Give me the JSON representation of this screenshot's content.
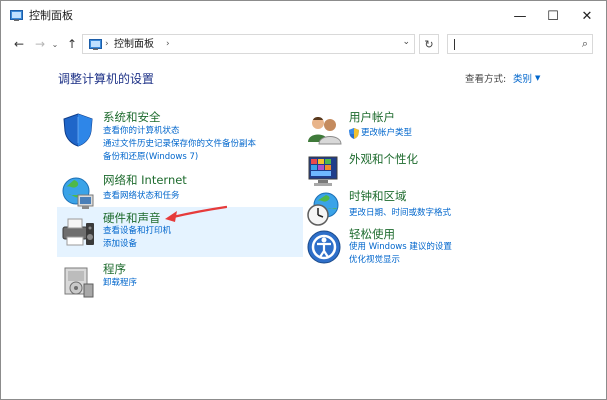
{
  "window": {
    "title": "控制面板",
    "controls": {
      "minimize": "—",
      "maximize": "☐",
      "close": "✕"
    }
  },
  "nav": {
    "back": "←",
    "forward": "→",
    "recent": "⌄",
    "up": "↑",
    "separator": "›",
    "address": "控制面板",
    "dropdown": "⌄",
    "refresh": "↻",
    "search_icon": "⌕"
  },
  "header": {
    "title": "调整计算机的设置",
    "view_by_label": "查看方式:",
    "view_by_value": "类别",
    "view_by_caret": "▼"
  },
  "categories": [
    {
      "icon": "shield-icon",
      "title": "系统和安全",
      "links": [
        "查看你的计算机状态",
        "通过文件历史记录保存你的文件备份副本",
        "备份和还原(Windows 7)"
      ]
    },
    {
      "icon": "network-globe-icon",
      "title": "网络和 Internet",
      "links": [
        "查看网络状态和任务"
      ]
    },
    {
      "icon": "printer-speaker-icon",
      "title": "硬件和声音",
      "links": [
        "查看设备和打印机",
        "添加设备"
      ],
      "highlighted": true
    },
    {
      "icon": "program-box-icon",
      "title": "程序",
      "links": [
        "卸载程序"
      ]
    },
    {
      "icon": "users-icon",
      "title": "用户帐户",
      "links": [
        "更改帐户类型"
      ]
    },
    {
      "icon": "appearance-monitor-icon",
      "title": "外观和个性化",
      "links": []
    },
    {
      "icon": "clock-globe-icon",
      "title": "时钟和区域",
      "links": [
        "更改日期、时间或数字格式"
      ]
    },
    {
      "icon": "accessibility-icon",
      "title": "轻松使用",
      "links": [
        "使用 Windows 建议的设置",
        "优化视觉显示"
      ]
    }
  ],
  "colors": {
    "title_green": "#1e6b2e",
    "link_blue": "#0066cc",
    "heading_blue": "#1e3287",
    "hover_bg": "#e5f3ff",
    "annotation_red": "#e63b3b"
  }
}
